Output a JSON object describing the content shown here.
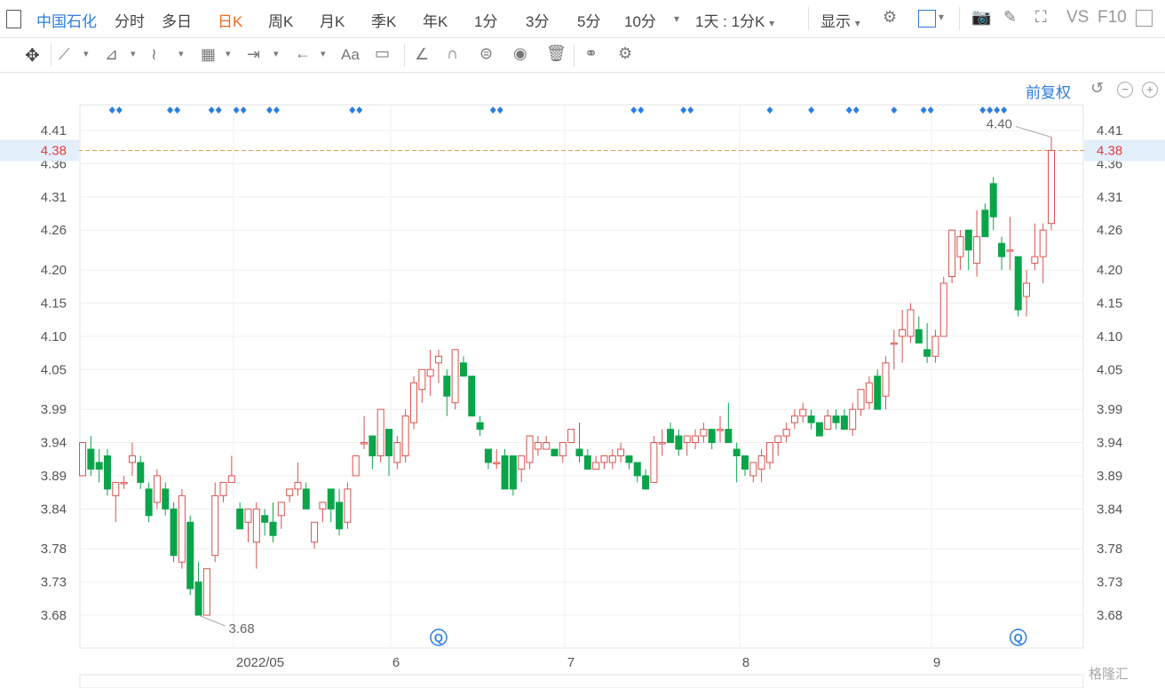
{
  "header": {
    "stock_name": "中国石化",
    "tabs": [
      "分时",
      "多日",
      "日K",
      "周K",
      "月K",
      "季K",
      "年K",
      "1分",
      "3分",
      "5分",
      "10分"
    ],
    "active_tab": "日K",
    "period_select": "1天 : 1分K",
    "display_label": "显示",
    "vs_label": "VS",
    "f10_label": "F10"
  },
  "chart_controls": {
    "adjust_label": "前复权"
  },
  "colors": {
    "up": "#d9534f",
    "down": "#0aa54a",
    "accent": "#f26b1d",
    "link": "#2b7de0",
    "marker": "#2b7de0",
    "current_price_line": "#e0a050"
  },
  "watermark": "格隆汇",
  "chart_data": {
    "type": "candlestick",
    "y_ticks": [
      "4.41",
      "4.36",
      "4.31",
      "4.26",
      "4.20",
      "4.15",
      "4.10",
      "4.05",
      "3.99",
      "3.94",
      "3.89",
      "3.84",
      "3.78",
      "3.73",
      "3.68"
    ],
    "x_labels": [
      "2022/05",
      "6",
      "7",
      "8",
      "9"
    ],
    "current_price": "4.38",
    "max_annotation": "4.40",
    "min_annotation": "3.68",
    "grid": true,
    "ohlc": [
      [
        3.89,
        3.94,
        3.89,
        3.94
      ],
      [
        3.93,
        3.95,
        3.89,
        3.9
      ],
      [
        3.91,
        3.93,
        3.88,
        3.9
      ],
      [
        3.92,
        3.93,
        3.86,
        3.87
      ],
      [
        3.86,
        3.87,
        3.82,
        3.88
      ],
      [
        3.88,
        3.89,
        3.87,
        3.88
      ],
      [
        3.91,
        3.94,
        3.89,
        3.92
      ],
      [
        3.91,
        3.92,
        3.87,
        3.88
      ],
      [
        3.87,
        3.88,
        3.82,
        3.83
      ],
      [
        3.85,
        3.9,
        3.84,
        3.89
      ],
      [
        3.87,
        3.88,
        3.83,
        3.84
      ],
      [
        3.84,
        3.85,
        3.76,
        3.77
      ],
      [
        3.76,
        3.87,
        3.75,
        3.86
      ],
      [
        3.82,
        3.83,
        3.71,
        3.72
      ],
      [
        3.73,
        3.76,
        3.68,
        3.68
      ],
      [
        3.68,
        3.75,
        3.68,
        3.75
      ],
      [
        3.77,
        3.88,
        3.76,
        3.86
      ],
      [
        3.86,
        3.88,
        3.85,
        3.88
      ],
      [
        3.88,
        3.92,
        3.88,
        3.89
      ],
      [
        3.84,
        3.85,
        3.81,
        3.81
      ],
      [
        3.82,
        3.84,
        3.79,
        3.84
      ],
      [
        3.79,
        3.85,
        3.75,
        3.84
      ],
      [
        3.83,
        3.84,
        3.8,
        3.82
      ],
      [
        3.82,
        3.85,
        3.79,
        3.8
      ],
      [
        3.83,
        3.85,
        3.81,
        3.85
      ],
      [
        3.86,
        3.87,
        3.85,
        3.87
      ],
      [
        3.87,
        3.91,
        3.86,
        3.88
      ],
      [
        3.87,
        3.88,
        3.84,
        3.84
      ],
      [
        3.79,
        3.82,
        3.78,
        3.82
      ],
      [
        3.84,
        3.85,
        3.82,
        3.85
      ],
      [
        3.87,
        3.87,
        3.82,
        3.84
      ],
      [
        3.85,
        3.87,
        3.8,
        3.81
      ],
      [
        3.82,
        3.88,
        3.81,
        3.87
      ],
      [
        3.89,
        3.92,
        3.89,
        3.92
      ],
      [
        3.94,
        3.98,
        3.93,
        3.94
      ],
      [
        3.95,
        3.95,
        3.9,
        3.92
      ],
      [
        3.92,
        3.99,
        3.91,
        3.99
      ],
      [
        3.96,
        3.96,
        3.89,
        3.92
      ],
      [
        3.91,
        3.95,
        3.9,
        3.94
      ],
      [
        3.92,
        3.99,
        3.91,
        3.98
      ],
      [
        3.97,
        4.04,
        3.96,
        4.03
      ],
      [
        4.02,
        4.05,
        4.0,
        4.05
      ],
      [
        4.04,
        4.08,
        4.01,
        4.05
      ],
      [
        4.06,
        4.08,
        4.03,
        4.07
      ],
      [
        4.04,
        4.05,
        3.98,
        4.01
      ],
      [
        4.0,
        4.08,
        3.99,
        4.08
      ],
      [
        4.06,
        4.07,
        4.04,
        4.04
      ],
      [
        4.04,
        4.04,
        3.98,
        3.98
      ],
      [
        3.97,
        3.98,
        3.95,
        3.96
      ],
      [
        3.93,
        3.93,
        3.9,
        3.91
      ],
      [
        3.91,
        3.93,
        3.9,
        3.91
      ],
      [
        3.92,
        3.93,
        3.87,
        3.87
      ],
      [
        3.92,
        3.92,
        3.86,
        3.87
      ],
      [
        3.9,
        3.92,
        3.88,
        3.92
      ],
      [
        3.91,
        3.95,
        3.9,
        3.95
      ],
      [
        3.93,
        3.95,
        3.92,
        3.94
      ],
      [
        3.93,
        3.95,
        3.93,
        3.94
      ],
      [
        3.93,
        3.93,
        3.92,
        3.92
      ],
      [
        3.92,
        3.94,
        3.91,
        3.94
      ],
      [
        3.94,
        3.96,
        3.94,
        3.96
      ],
      [
        3.93,
        3.97,
        3.91,
        3.92
      ],
      [
        3.92,
        3.93,
        3.9,
        3.9
      ],
      [
        3.9,
        3.92,
        3.9,
        3.91
      ],
      [
        3.91,
        3.92,
        3.9,
        3.92
      ],
      [
        3.91,
        3.93,
        3.9,
        3.92
      ],
      [
        3.92,
        3.94,
        3.91,
        3.93
      ],
      [
        3.92,
        3.92,
        3.9,
        3.91
      ],
      [
        3.91,
        3.91,
        3.88,
        3.89
      ],
      [
        3.89,
        3.9,
        3.87,
        3.87
      ],
      [
        3.88,
        3.95,
        3.88,
        3.94
      ],
      [
        3.94,
        3.96,
        3.92,
        3.94
      ],
      [
        3.96,
        3.97,
        3.94,
        3.94
      ],
      [
        3.95,
        3.96,
        3.92,
        3.93
      ],
      [
        3.94,
        3.95,
        3.92,
        3.95
      ],
      [
        3.94,
        3.96,
        3.93,
        3.95
      ],
      [
        3.95,
        3.97,
        3.94,
        3.96
      ],
      [
        3.96,
        3.96,
        3.93,
        3.94
      ],
      [
        3.96,
        3.98,
        3.94,
        3.96
      ],
      [
        3.96,
        4.0,
        3.94,
        3.94
      ],
      [
        3.93,
        3.94,
        3.88,
        3.92
      ],
      [
        3.92,
        3.92,
        3.89,
        3.9
      ],
      [
        3.89,
        3.91,
        3.88,
        3.91
      ],
      [
        3.9,
        3.93,
        3.88,
        3.92
      ],
      [
        3.91,
        3.94,
        3.9,
        3.94
      ],
      [
        3.94,
        3.95,
        3.92,
        3.95
      ],
      [
        3.95,
        3.97,
        3.94,
        3.96
      ],
      [
        3.97,
        3.99,
        3.96,
        3.98
      ],
      [
        3.98,
        4.0,
        3.97,
        3.99
      ],
      [
        3.98,
        3.99,
        3.96,
        3.97
      ],
      [
        3.97,
        3.97,
        3.95,
        3.95
      ],
      [
        3.96,
        3.99,
        3.96,
        3.98
      ],
      [
        3.98,
        3.99,
        3.96,
        3.97
      ],
      [
        3.98,
        3.99,
        3.96,
        3.96
      ],
      [
        3.96,
        4.0,
        3.95,
        3.99
      ],
      [
        3.99,
        4.02,
        3.98,
        4.02
      ],
      [
        4.0,
        4.04,
        3.99,
        4.03
      ],
      [
        4.04,
        4.05,
        3.99,
        3.99
      ],
      [
        4.01,
        4.07,
        3.99,
        4.06
      ],
      [
        4.09,
        4.11,
        4.05,
        4.09
      ],
      [
        4.1,
        4.14,
        4.06,
        4.11
      ],
      [
        4.1,
        4.15,
        4.09,
        4.14
      ],
      [
        4.11,
        4.13,
        4.09,
        4.09
      ],
      [
        4.08,
        4.12,
        4.06,
        4.07
      ],
      [
        4.07,
        4.11,
        4.06,
        4.1
      ],
      [
        4.1,
        4.19,
        4.1,
        4.18
      ],
      [
        4.19,
        4.26,
        4.18,
        4.26
      ],
      [
        4.22,
        4.26,
        4.2,
        4.25
      ],
      [
        4.26,
        4.26,
        4.2,
        4.23
      ],
      [
        4.21,
        4.29,
        4.19,
        4.25
      ],
      [
        4.29,
        4.3,
        4.26,
        4.25
      ],
      [
        4.33,
        4.34,
        4.26,
        4.28
      ],
      [
        4.24,
        4.25,
        4.2,
        4.22
      ],
      [
        4.23,
        4.28,
        4.2,
        4.23
      ],
      [
        4.22,
        4.22,
        4.13,
        4.14
      ],
      [
        4.16,
        4.2,
        4.13,
        4.18
      ],
      [
        4.21,
        4.27,
        4.2,
        4.22
      ],
      [
        4.22,
        4.27,
        4.18,
        4.26
      ],
      [
        4.27,
        4.4,
        4.26,
        4.38
      ]
    ],
    "markers_top": [
      {
        "index": 4,
        "count": 2
      },
      {
        "index": 11,
        "count": 2
      },
      {
        "index": 16,
        "count": 2
      },
      {
        "index": 19,
        "count": 2
      },
      {
        "index": 23,
        "count": 2
      },
      {
        "index": 33,
        "count": 2
      },
      {
        "index": 50,
        "count": 2
      },
      {
        "index": 67,
        "count": 2
      },
      {
        "index": 73,
        "count": 2
      },
      {
        "index": 83,
        "count": 1
      },
      {
        "index": 88,
        "count": 1
      },
      {
        "index": 93,
        "count": 2
      },
      {
        "index": 98,
        "count": 1
      },
      {
        "index": 102,
        "count": 2
      },
      {
        "index": 110,
        "count": 4
      }
    ],
    "markers_bottom": [
      {
        "index": 43,
        "symbol": "Q"
      },
      {
        "index": 113,
        "symbol": "Q"
      }
    ]
  }
}
